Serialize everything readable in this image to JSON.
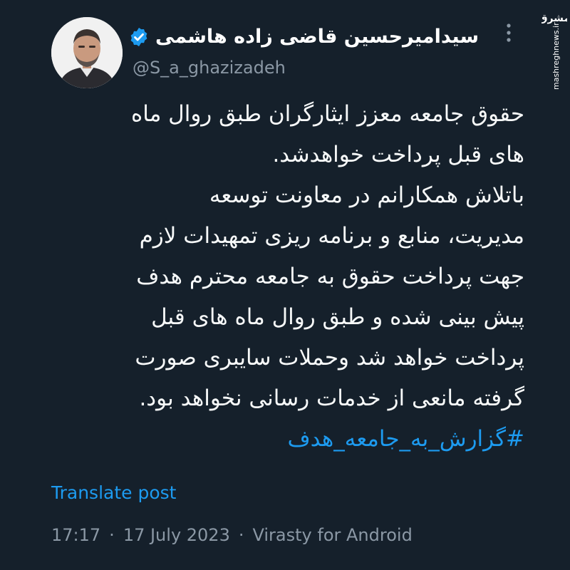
{
  "author": {
    "display_name": "سیدامیرحسین قاضی زاده هاشمی",
    "handle": "@S_a_ghazizadeh",
    "verified": true
  },
  "post": {
    "text": "حقوق جامعه معزز ایثارگران طبق روال ماه\nهای قبل پرداخت خواهدشد.\nباتلاش همکارانم در معاونت توسعه\nمدیریت، منابع و برنامه ریزی تمهیدات لازم\nجهت پرداخت حقوق به جامعه محترم هدف\nپیش بینی شده و طبق روال ماه های قبل\nپرداخت خواهد شد وحملات سایبری صورت\nگرفته مانعی از خدمات رسانی نخواهد بود.",
    "hashtag": "#گزارش_به_جامعه_هدف"
  },
  "translate_label": "Translate post",
  "meta": {
    "time": "17:17",
    "date": "17 July 2023",
    "client": "Virasty for Android",
    "separator": "·"
  },
  "watermark": {
    "logo_text": "مشرق",
    "site": "mashreghnews.ir"
  },
  "colors": {
    "background": "#15202b",
    "text": "#f7f9f9",
    "secondary": "#8b98a5",
    "accent": "#1d9bf0"
  },
  "icons": {
    "verified": "verified-badge-icon",
    "more": "more-options-icon"
  }
}
